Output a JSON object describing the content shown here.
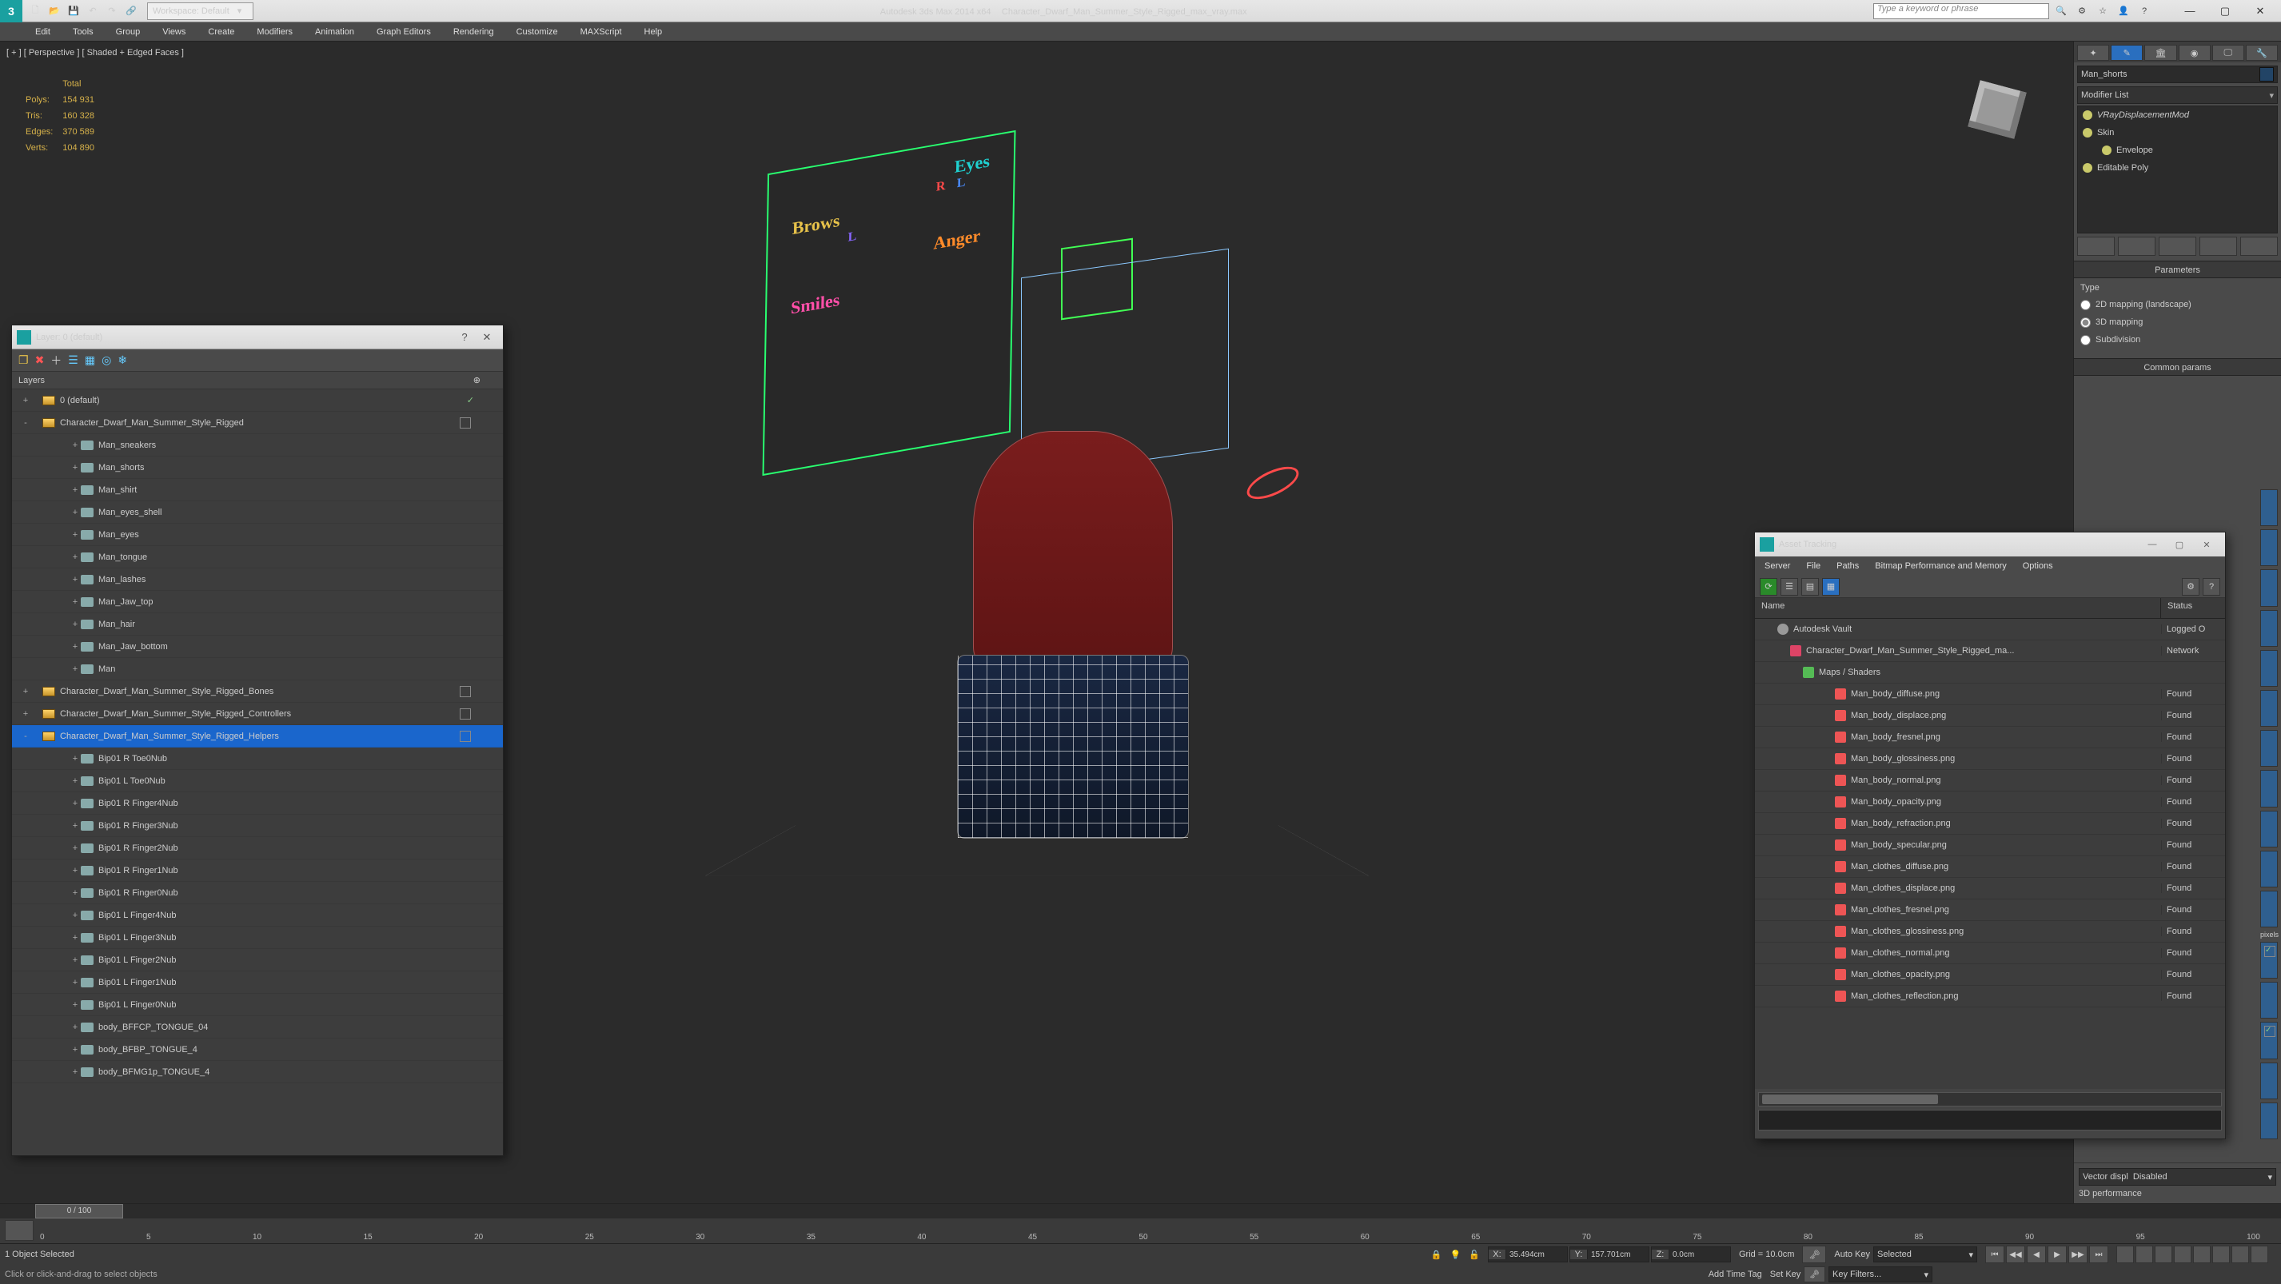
{
  "titlebar": {
    "app_abbrev": "3",
    "workspace_label": "Workspace: Default",
    "title_left": "Autodesk 3ds Max  2014 x64",
    "title_right": "Character_Dwarf_Man_Summer_Style_Rigged_max_vray.max",
    "search_placeholder": "Type a keyword or phrase"
  },
  "menu": [
    "Edit",
    "Tools",
    "Group",
    "Views",
    "Create",
    "Modifiers",
    "Animation",
    "Graph Editors",
    "Rendering",
    "Customize",
    "MAXScript",
    "Help"
  ],
  "viewport": {
    "label": "[ + ] [ Perspective ] [ Shaded + Edged Faces ]",
    "stats": {
      "total_label": "Total",
      "polys_label": "Polys:",
      "polys": "154 931",
      "tris_label": "Tris:",
      "tris": "160 328",
      "edges_label": "Edges:",
      "edges": "370 589",
      "verts_label": "Verts:",
      "verts": "104 890"
    },
    "ctrl_board": {
      "eyes": "Eyes",
      "brows": "Brows",
      "anger": "Anger",
      "smiles": "Smiles",
      "l1": "L",
      "l2": "L",
      "r1": "R"
    }
  },
  "layers_panel": {
    "title": "Layer: 0 (default)",
    "header": "Layers",
    "tree": [
      {
        "d": 0,
        "t": "layer",
        "exp": "+",
        "label": "0 (default)",
        "check": true
      },
      {
        "d": 0,
        "t": "layer",
        "exp": "-",
        "label": "Character_Dwarf_Man_Summer_Style_Rigged",
        "cb": true
      },
      {
        "d": 2,
        "t": "obj",
        "label": "Man_sneakers"
      },
      {
        "d": 2,
        "t": "obj",
        "label": "Man_shorts"
      },
      {
        "d": 2,
        "t": "obj",
        "label": "Man_shirt"
      },
      {
        "d": 2,
        "t": "obj",
        "label": "Man_eyes_shell"
      },
      {
        "d": 2,
        "t": "obj",
        "label": "Man_eyes"
      },
      {
        "d": 2,
        "t": "obj",
        "label": "Man_tongue"
      },
      {
        "d": 2,
        "t": "obj",
        "label": "Man_lashes"
      },
      {
        "d": 2,
        "t": "obj",
        "label": "Man_Jaw_top"
      },
      {
        "d": 2,
        "t": "obj",
        "label": "Man_hair"
      },
      {
        "d": 2,
        "t": "obj",
        "label": "Man_Jaw_bottom"
      },
      {
        "d": 2,
        "t": "obj",
        "label": "Man"
      },
      {
        "d": 0,
        "t": "layer",
        "exp": "+",
        "label": "Character_Dwarf_Man_Summer_Style_Rigged_Bones",
        "cb": true
      },
      {
        "d": 0,
        "t": "layer",
        "exp": "+",
        "label": "Character_Dwarf_Man_Summer_Style_Rigged_Controllers",
        "cb": true
      },
      {
        "d": 0,
        "t": "layer",
        "exp": "-",
        "label": "Character_Dwarf_Man_Summer_Style_Rigged_Helpers",
        "cb": true,
        "sel": true
      },
      {
        "d": 2,
        "t": "obj",
        "label": "Bip01 R Toe0Nub"
      },
      {
        "d": 2,
        "t": "obj",
        "label": "Bip01 L Toe0Nub"
      },
      {
        "d": 2,
        "t": "obj",
        "label": "Bip01 R Finger4Nub"
      },
      {
        "d": 2,
        "t": "obj",
        "label": "Bip01 R Finger3Nub"
      },
      {
        "d": 2,
        "t": "obj",
        "label": "Bip01 R Finger2Nub"
      },
      {
        "d": 2,
        "t": "obj",
        "label": "Bip01 R Finger1Nub"
      },
      {
        "d": 2,
        "t": "obj",
        "label": "Bip01 R Finger0Nub"
      },
      {
        "d": 2,
        "t": "obj",
        "label": "Bip01 L Finger4Nub"
      },
      {
        "d": 2,
        "t": "obj",
        "label": "Bip01 L Finger3Nub"
      },
      {
        "d": 2,
        "t": "obj",
        "label": "Bip01 L Finger2Nub"
      },
      {
        "d": 2,
        "t": "obj",
        "label": "Bip01 L Finger1Nub"
      },
      {
        "d": 2,
        "t": "obj",
        "label": "Bip01 L Finger0Nub"
      },
      {
        "d": 2,
        "t": "obj",
        "label": "body_BFFCP_TONGUE_04"
      },
      {
        "d": 2,
        "t": "obj",
        "label": "body_BFBP_TONGUE_4"
      },
      {
        "d": 2,
        "t": "obj",
        "label": "body_BFMG1p_TONGUE_4"
      }
    ]
  },
  "asset_panel": {
    "title": "Asset Tracking",
    "menu": [
      "Server",
      "File",
      "Paths",
      "Bitmap Performance and Memory",
      "Options"
    ],
    "col_name": "Name",
    "col_status": "Status",
    "rows": [
      {
        "pad": 28,
        "ico": "vault",
        "name": "Autodesk Vault",
        "status": "Logged O"
      },
      {
        "pad": 44,
        "ico": "max",
        "name": "Character_Dwarf_Man_Summer_Style_Rigged_ma...",
        "status": "Network"
      },
      {
        "pad": 60,
        "ico": "fold",
        "name": "Maps / Shaders",
        "status": ""
      },
      {
        "pad": 100,
        "ico": "png",
        "name": "Man_body_diffuse.png",
        "status": "Found"
      },
      {
        "pad": 100,
        "ico": "png",
        "name": "Man_body_displace.png",
        "status": "Found"
      },
      {
        "pad": 100,
        "ico": "png",
        "name": "Man_body_fresnel.png",
        "status": "Found"
      },
      {
        "pad": 100,
        "ico": "png",
        "name": "Man_body_glossiness.png",
        "status": "Found"
      },
      {
        "pad": 100,
        "ico": "png",
        "name": "Man_body_normal.png",
        "status": "Found"
      },
      {
        "pad": 100,
        "ico": "png",
        "name": "Man_body_opacity.png",
        "status": "Found"
      },
      {
        "pad": 100,
        "ico": "png",
        "name": "Man_body_refraction.png",
        "status": "Found"
      },
      {
        "pad": 100,
        "ico": "png",
        "name": "Man_body_specular.png",
        "status": "Found"
      },
      {
        "pad": 100,
        "ico": "png",
        "name": "Man_clothes_diffuse.png",
        "status": "Found"
      },
      {
        "pad": 100,
        "ico": "png",
        "name": "Man_clothes_displace.png",
        "status": "Found"
      },
      {
        "pad": 100,
        "ico": "png",
        "name": "Man_clothes_fresnel.png",
        "status": "Found"
      },
      {
        "pad": 100,
        "ico": "png",
        "name": "Man_clothes_glossiness.png",
        "status": "Found"
      },
      {
        "pad": 100,
        "ico": "png",
        "name": "Man_clothes_normal.png",
        "status": "Found"
      },
      {
        "pad": 100,
        "ico": "png",
        "name": "Man_clothes_opacity.png",
        "status": "Found"
      },
      {
        "pad": 100,
        "ico": "png",
        "name": "Man_clothes_reflection.png",
        "status": "Found"
      }
    ]
  },
  "cmdpanel": {
    "obj_name": "Man_shorts",
    "modlist_label": "Modifier List",
    "stack": [
      "VRayDisplacementMod",
      "Skin",
      "Envelope",
      "Editable Poly"
    ],
    "rollout_params": "Parameters",
    "type_label": "Type",
    "opt1": "2D mapping (landscape)",
    "opt2": "3D mapping",
    "opt3": "Subdivision",
    "rollout_common": "Common params",
    "vector_label": "Vector displ",
    "vector_value": "Disabled",
    "perf_label": "3D performance",
    "side_label_pixels": "pixels"
  },
  "timeline": {
    "knob": "0 / 100",
    "ticks": [
      "0",
      "5",
      "10",
      "15",
      "20",
      "25",
      "30",
      "35",
      "40",
      "45",
      "50",
      "55",
      "60",
      "65",
      "70",
      "75",
      "80",
      "85",
      "90",
      "95",
      "100"
    ]
  },
  "status": {
    "sel": "1 Object Selected",
    "x_label": "X:",
    "x": "35.494cm",
    "y_label": "Y:",
    "y": "157.701cm",
    "z_label": "Z:",
    "z": "0.0cm",
    "grid": "Grid = 10.0cm",
    "autokey": "Auto Key",
    "setkey": "Set Key",
    "selected": "Selected",
    "keyfilters": "Key Filters...",
    "addtimetag": "Add Time Tag",
    "prompt": "Click or click-and-drag to select objects"
  }
}
